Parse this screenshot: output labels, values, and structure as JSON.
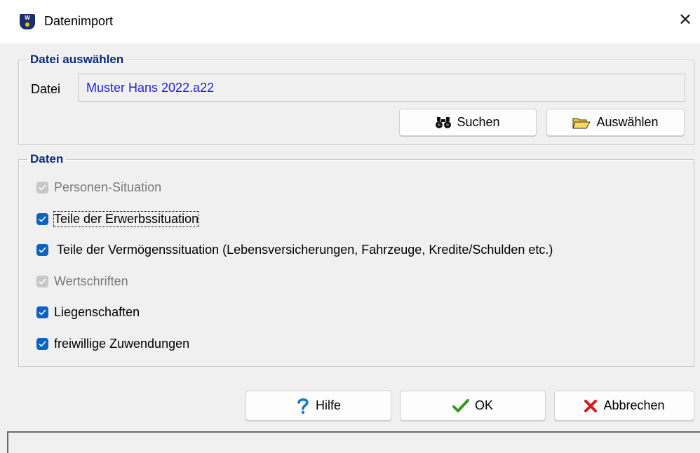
{
  "window": {
    "title": "Datenimport",
    "app_icon_text": "W",
    "close_glyph": "✕"
  },
  "file_group": {
    "legend": "Datei auswählen",
    "label": "Datei",
    "value": "Muster Hans 2022.a22",
    "value_color": "#1f1fe0",
    "buttons": {
      "search": {
        "label": "Suchen",
        "icon": "binoculars-icon"
      },
      "select": {
        "label": "Auswählen",
        "icon": "open-folder-icon"
      }
    }
  },
  "data_group": {
    "legend": "Daten",
    "items": [
      {
        "label": "Personen-Situation",
        "checked": true,
        "enabled": false
      },
      {
        "label": "Teile der Erwerbssituation",
        "checked": true,
        "enabled": true,
        "focused": true
      },
      {
        "label": "Teile der Vermögenssituation (Lebensversicherungen, Fahrzeuge, Kredite/Schulden etc.)",
        "checked": true,
        "enabled": true
      },
      {
        "label": "Wertschriften",
        "checked": true,
        "enabled": false
      },
      {
        "label": "Liegenschaften",
        "checked": true,
        "enabled": true
      },
      {
        "label": "freiwillige Zuwendungen",
        "checked": true,
        "enabled": true
      }
    ]
  },
  "footer": {
    "help": {
      "label": "Hilfe",
      "icon": "question-mark-icon"
    },
    "ok": {
      "label": "OK",
      "icon": "checkmark-icon"
    },
    "cancel": {
      "label": "Abbrechen",
      "icon": "x-cancel-icon"
    }
  },
  "colors": {
    "legend": "#0a2a7a",
    "checkbox_enabled": "#0b63c4",
    "checkbox_disabled": "#c7c7c7",
    "ok_green": "#2e9b1e",
    "cancel_red": "#d11b1b",
    "help_blue": "#1677c9"
  }
}
